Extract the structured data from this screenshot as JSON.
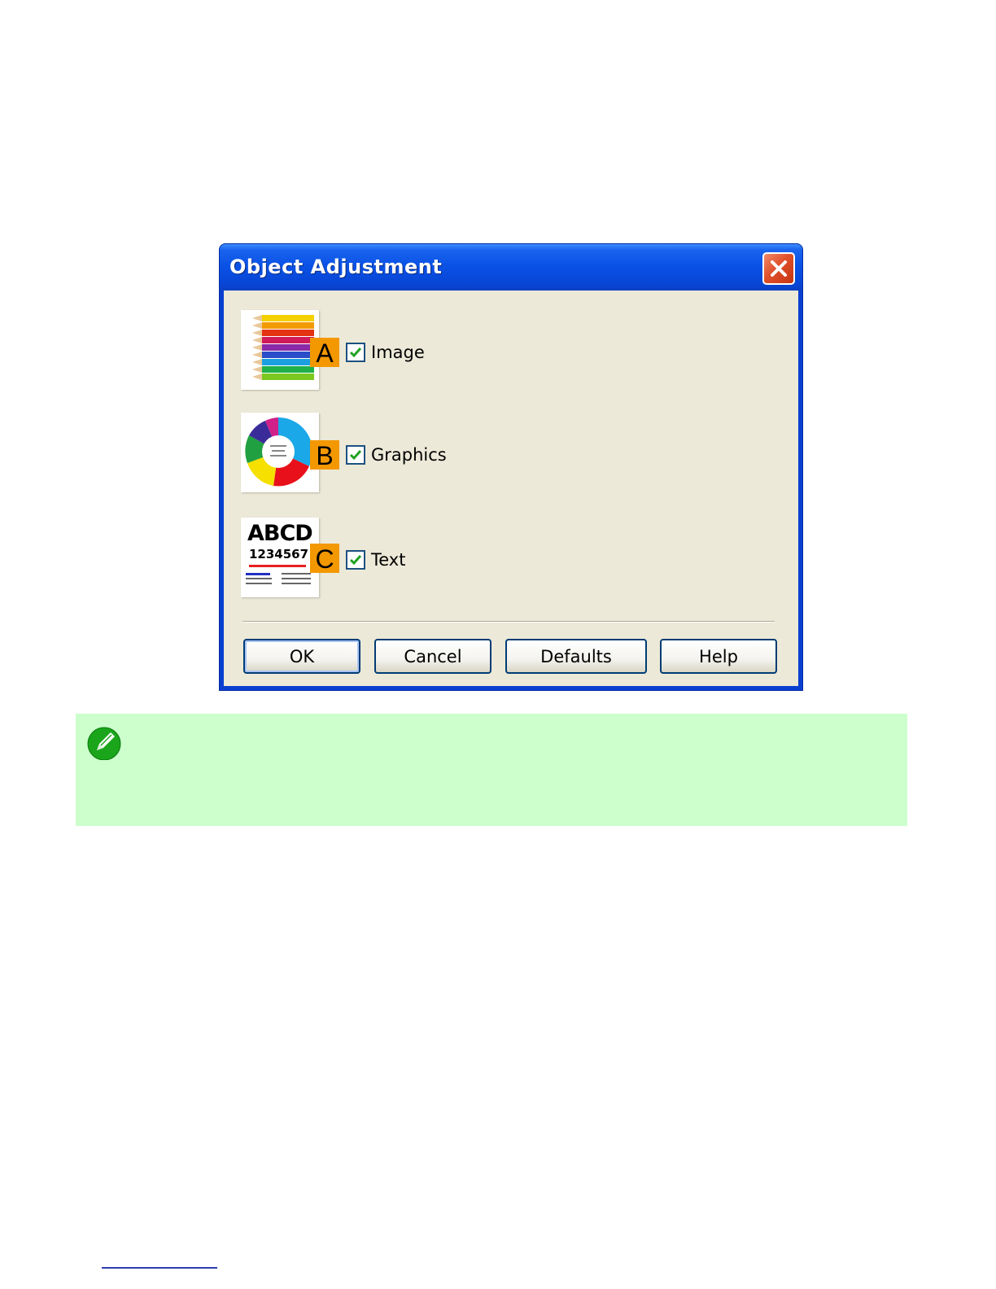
{
  "dialog": {
    "title": "Object Adjustment",
    "close_icon": "close-icon",
    "options": [
      {
        "badge": "A",
        "label": "Image",
        "checked": true,
        "thumbnail": "colored-pencils-thumbnail"
      },
      {
        "badge": "B",
        "label": "Graphics",
        "checked": true,
        "thumbnail": "pie-chart-thumbnail"
      },
      {
        "badge": "C",
        "label": "Text",
        "checked": true,
        "thumbnail": "text-sample-thumbnail",
        "thumb_text": [
          "ABCD",
          "1234567"
        ]
      }
    ],
    "buttons": {
      "ok": "OK",
      "cancel": "Cancel",
      "defaults": "Defaults",
      "help": "Help"
    }
  },
  "note": {
    "icon": "pencil-note-icon"
  },
  "colors": {
    "title_bar": "#0a52e6",
    "client_bg": "#ece9d8",
    "badge": "#f39800",
    "note_bg": "#ccffcc",
    "close_button": "#e0502a"
  }
}
